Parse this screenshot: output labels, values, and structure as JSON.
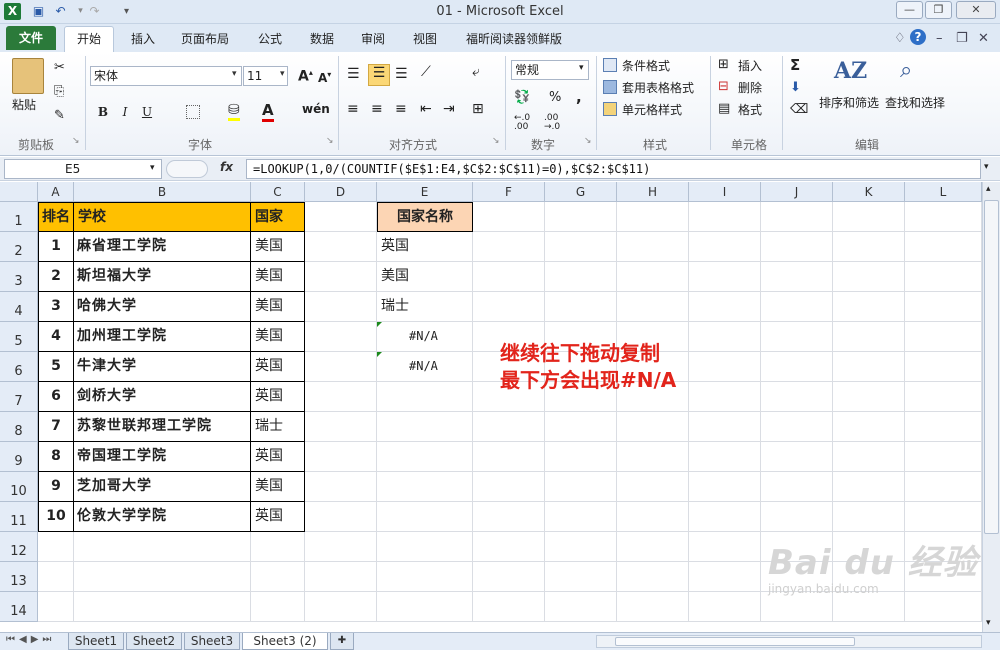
{
  "window": {
    "title": "01 - Microsoft Excel"
  },
  "tabs": [
    "文件",
    "开始",
    "插入",
    "页面布局",
    "公式",
    "数据",
    "审阅",
    "视图",
    "福昕阅读器领鲜版"
  ],
  "ribbon": {
    "clipboard": {
      "label": "剪贴板",
      "paste": "粘贴"
    },
    "font": {
      "label": "字体",
      "name": "宋体",
      "size": "11",
      "bold": "B",
      "italic": "I",
      "underline": "U"
    },
    "alignment": {
      "label": "对齐方式"
    },
    "number": {
      "label": "数字",
      "format": "常规",
      "percent": "%",
      "comma": ","
    },
    "styles": {
      "label": "样式",
      "conditional": "条件格式",
      "table": "套用表格格式",
      "cell": "单元格样式"
    },
    "cells": {
      "label": "单元格",
      "insert": "插入",
      "delete": "删除",
      "format": "格式"
    },
    "editing": {
      "label": "编辑",
      "sort": "排序和筛选",
      "find": "查找和选择",
      "sum": "Σ"
    }
  },
  "formula_bar": {
    "cell_ref": "E5",
    "fx": "fx",
    "formula": "=LOOKUP(1,0/(COUNTIF($E$1:E4,$C$2:$C$11)=0),$C$2:$C$11)"
  },
  "columns": [
    "A",
    "B",
    "C",
    "D",
    "E",
    "F",
    "G",
    "H",
    "I",
    "J",
    "K",
    "L"
  ],
  "rows": [
    "1",
    "2",
    "3",
    "4",
    "5",
    "6",
    "7",
    "8",
    "9",
    "10",
    "11",
    "12",
    "13",
    "14"
  ],
  "table": {
    "headers": [
      "排名",
      "学校",
      "国家"
    ],
    "rows": [
      {
        "rank": "1",
        "school": "麻省理工学院",
        "country": "美国"
      },
      {
        "rank": "2",
        "school": "斯坦福大学",
        "country": "美国"
      },
      {
        "rank": "3",
        "school": "哈佛大学",
        "country": "美国"
      },
      {
        "rank": "4",
        "school": "加州理工学院",
        "country": "美国"
      },
      {
        "rank": "5",
        "school": "牛津大学",
        "country": "英国"
      },
      {
        "rank": "6",
        "school": "剑桥大学",
        "country": "英国"
      },
      {
        "rank": "7",
        "school": "苏黎世联邦理工学院",
        "country": "瑞士"
      },
      {
        "rank": "8",
        "school": "帝国理工学院",
        "country": "英国"
      },
      {
        "rank": "9",
        "school": "芝加哥大学",
        "country": "美国"
      },
      {
        "rank": "10",
        "school": "伦敦大学学院",
        "country": "英国"
      }
    ]
  },
  "country_list": {
    "header": "国家名称",
    "values": [
      "英国",
      "美国",
      "瑞士",
      "#N/A",
      "#N/A"
    ]
  },
  "annotation": {
    "line1": "继续往下拖动复制",
    "line2": "最下方会出现#N/A"
  },
  "sheets": [
    "Sheet1",
    "Sheet2",
    "Sheet3",
    "Sheet3 (2)"
  ],
  "active_sheet": "Sheet3 (2)",
  "watermark": {
    "brand": "Bai du 经验",
    "url": "jingyan.baidu.com"
  }
}
